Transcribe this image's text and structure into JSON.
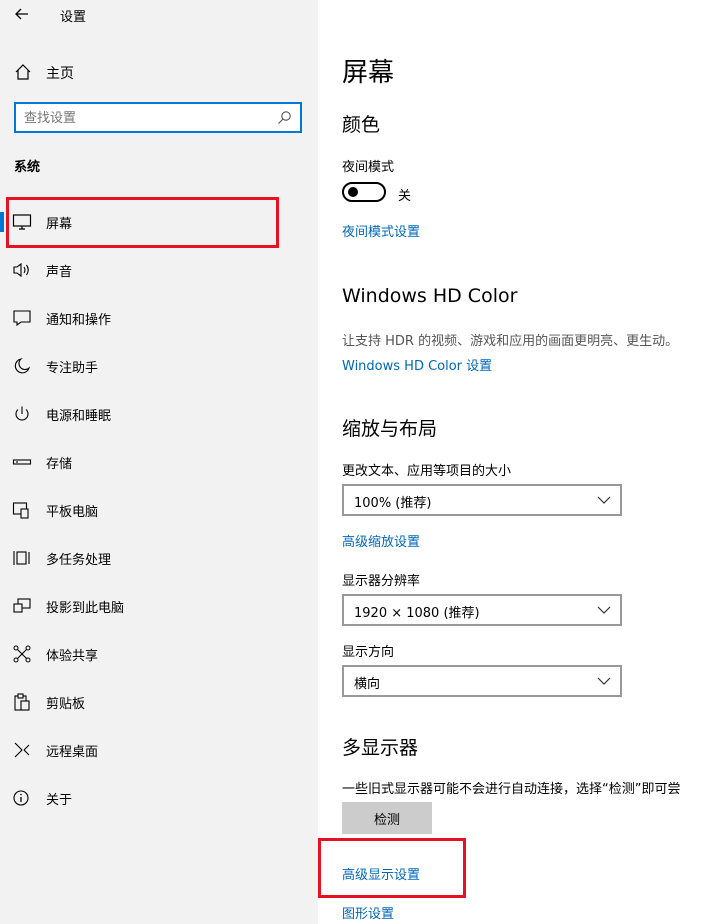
{
  "app": {
    "title": "设置"
  },
  "sidebar": {
    "home_label": "主页",
    "search_placeholder": "查找设置",
    "section_label": "系统",
    "items": [
      {
        "label": "屏幕",
        "icon": "monitor-icon",
        "active": true
      },
      {
        "label": "声音",
        "icon": "speaker-icon"
      },
      {
        "label": "通知和操作",
        "icon": "notification-icon"
      },
      {
        "label": "专注助手",
        "icon": "moon-icon"
      },
      {
        "label": "电源和睡眠",
        "icon": "power-icon"
      },
      {
        "label": "存储",
        "icon": "storage-icon"
      },
      {
        "label": "平板电脑",
        "icon": "tablet-icon"
      },
      {
        "label": "多任务处理",
        "icon": "multitask-icon"
      },
      {
        "label": "投影到此电脑",
        "icon": "project-icon"
      },
      {
        "label": "体验共享",
        "icon": "share-icon"
      },
      {
        "label": "剪贴板",
        "icon": "clipboard-icon"
      },
      {
        "label": "远程桌面",
        "icon": "remote-icon"
      },
      {
        "label": "关于",
        "icon": "info-icon"
      }
    ]
  },
  "main": {
    "title": "屏幕",
    "color": {
      "heading": "颜色",
      "night_mode_label": "夜间模式",
      "toggle_state": "关",
      "night_mode_link": "夜间模式设置"
    },
    "hdr": {
      "heading": "Windows HD Color",
      "description": "让支持 HDR 的视频、游戏和应用的画面更明亮、更生动。",
      "link": "Windows HD Color 设置"
    },
    "scale": {
      "heading": "缩放与布局",
      "text_size_label": "更改文本、应用等项目的大小",
      "text_size_value": "100% (推荐)",
      "advanced_link": "高级缩放设置",
      "resolution_label": "显示器分辨率",
      "resolution_value": "1920 × 1080 (推荐)",
      "orientation_label": "显示方向",
      "orientation_value": "横向"
    },
    "multi": {
      "heading": "多显示器",
      "description": "一些旧式显示器可能不会进行自动连接，选择“检测”即可尝",
      "detect_button": "检测",
      "advanced_display_link": "高级显示设置",
      "graphics_link": "图形设置"
    }
  },
  "colors": {
    "accent": "#0078d7",
    "link": "#0067b8",
    "highlight": "#e81123",
    "sidebar_bg": "#f2f2f2"
  }
}
